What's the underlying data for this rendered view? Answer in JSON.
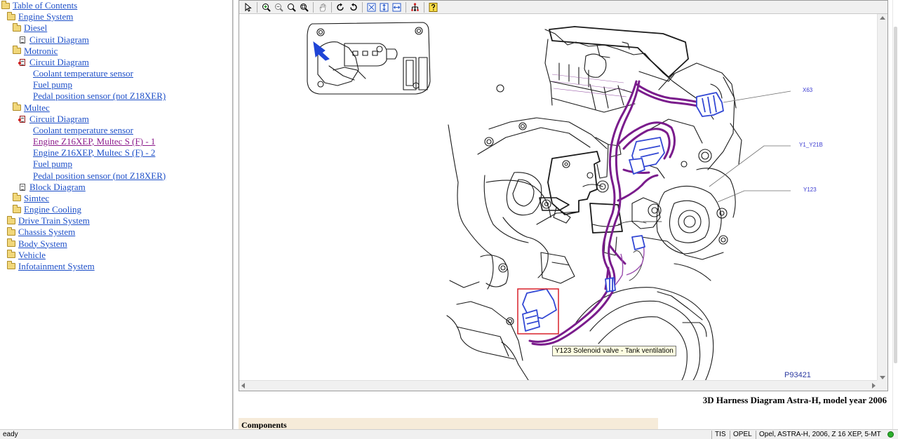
{
  "tree": {
    "items": [
      {
        "label": "Table of Contents",
        "icon": "folder-icon",
        "level": 0,
        "visited": false
      },
      {
        "label": "Engine System",
        "icon": "folder-icon",
        "level": 1,
        "visited": false
      },
      {
        "label": "Diesel",
        "icon": "folder-icon",
        "level": 2,
        "visited": false
      },
      {
        "label": "Circuit Diagram",
        "icon": "document-icon",
        "level": 3,
        "visited": false
      },
      {
        "label": "Motronic",
        "icon": "folder-icon",
        "level": 2,
        "visited": false
      },
      {
        "label": "Circuit Diagram",
        "icon": "document-red-icon",
        "level": 3,
        "visited": false
      },
      {
        "label": "Coolant temperature sensor",
        "icon": "none",
        "level": 4,
        "visited": false
      },
      {
        "label": "Fuel pump",
        "icon": "none",
        "level": 4,
        "visited": false
      },
      {
        "label": "Pedal position sensor (not Z18XER)",
        "icon": "none",
        "level": 4,
        "visited": false
      },
      {
        "label": "Multec",
        "icon": "folder-icon",
        "level": 2,
        "visited": false
      },
      {
        "label": "Circuit Diagram",
        "icon": "document-red-icon",
        "level": 3,
        "visited": false
      },
      {
        "label": "Coolant temperature sensor",
        "icon": "none",
        "level": 4,
        "visited": false
      },
      {
        "label": "Engine Z16XEP, Multec S (F) - 1",
        "icon": "none",
        "level": 4,
        "visited": true
      },
      {
        "label": "Engine Z16XEP, Multec S (F) - 2",
        "icon": "none",
        "level": 4,
        "visited": false
      },
      {
        "label": "Fuel pump",
        "icon": "none",
        "level": 4,
        "visited": false
      },
      {
        "label": "Pedal position sensor (not Z18XER)",
        "icon": "none",
        "level": 4,
        "visited": false
      },
      {
        "label": "Block Diagram",
        "icon": "document-icon",
        "level": 3,
        "visited": false
      },
      {
        "label": "Simtec",
        "icon": "folder-icon",
        "level": 2,
        "visited": false
      },
      {
        "label": "Engine Cooling",
        "icon": "folder-icon",
        "level": 2,
        "visited": false
      },
      {
        "label": "Drive Train System",
        "icon": "folder-icon",
        "level": 1,
        "visited": false
      },
      {
        "label": "Chassis System",
        "icon": "folder-icon",
        "level": 1,
        "visited": false
      },
      {
        "label": "Body System",
        "icon": "folder-icon",
        "level": 1,
        "visited": false
      },
      {
        "label": "Vehicle",
        "icon": "folder-icon",
        "level": 1,
        "visited": false
      },
      {
        "label": "Infotainment System",
        "icon": "folder-icon",
        "level": 1,
        "visited": false
      }
    ]
  },
  "toolbar": {
    "buttons": [
      {
        "icon": "select-arrow-icon"
      },
      {
        "icon": "zoom-in-icon"
      },
      {
        "icon": "zoom-out-icon"
      },
      {
        "icon": "zoom-icon"
      },
      {
        "icon": "zoom-area-icon"
      },
      {
        "icon": "pan-hand-icon"
      },
      {
        "icon": "rotate-right-icon"
      },
      {
        "icon": "rotate-left-icon"
      },
      {
        "icon": "fit-window-icon"
      },
      {
        "icon": "fit-height-icon"
      },
      {
        "icon": "fit-width-icon"
      },
      {
        "icon": "network-icon"
      },
      {
        "icon": "help-icon"
      }
    ]
  },
  "diagram": {
    "callouts": {
      "x63": "X63",
      "y1_y21b": "Y1_Y21B",
      "y123": "Y123"
    },
    "figure_id": "P93421",
    "tooltip": "Y123 Solenoid valve - Tank ventilation",
    "colors": {
      "harness": "#7a1c8c",
      "connector": "#3348d4",
      "highlight": "#d8202a"
    }
  },
  "page": {
    "title": "3D Harness Diagram Astra-H, model year 2006",
    "components_label": "Components"
  },
  "statusbar": {
    "status": "eady",
    "app": "TIS",
    "brand": "OPEL",
    "vehicle": "Opel, ASTRA-H, 2006, Z 16 XEP, 5-MT"
  }
}
